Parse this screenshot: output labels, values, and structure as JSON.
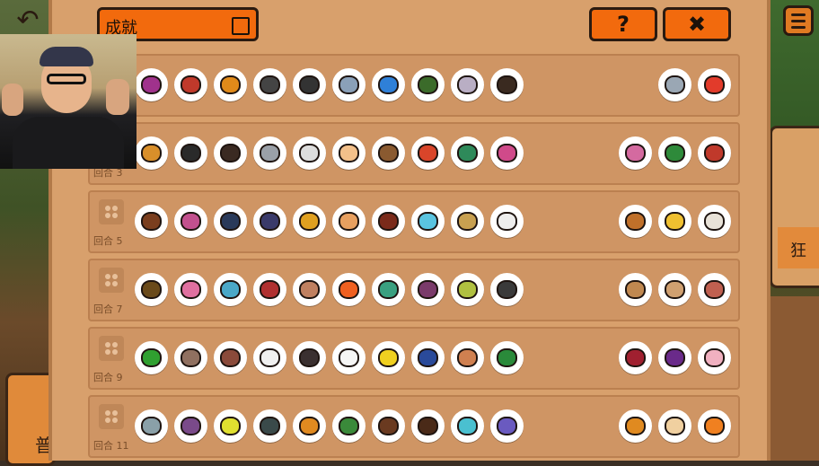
{
  "header": {
    "title": "成就",
    "help_label": "?",
    "close_label": "✖"
  },
  "side": {
    "left_card_text": "普",
    "right_card_text": "狂"
  },
  "rows": [
    {
      "label": "",
      "animals": [
        "#a0328c",
        "#c0392b",
        "#e08a1a",
        "#444",
        "#333",
        "#8aa0b8",
        "#2f80d8",
        "#3b6b2a",
        "#b9aec4",
        "#3a2a20"
      ],
      "foods": [
        "#9aa7b4",
        "#e23b2b"
      ]
    },
    {
      "label": "回合 3",
      "animals": [
        "#d98f2a",
        "#2a2a2a",
        "#3a2a22",
        "#9aa0a8",
        "#ddd",
        "#f3c08a",
        "#8a5a30",
        "#d9452a",
        "#2e8a5a",
        "#d04a8a"
      ],
      "foods": [
        "#d46aa0",
        "#2e8a3a",
        "#c0392b"
      ]
    },
    {
      "label": "回合 5",
      "animals": [
        "#7a3e1e",
        "#c2508e",
        "#2a3a5a",
        "#3a3a6a",
        "#e0a020",
        "#e8a060",
        "#7a2a1a",
        "#5ac4e0",
        "#c8a050",
        "#eeeeee"
      ],
      "foods": [
        "#c0702a",
        "#f0c030",
        "#e8e2d8"
      ]
    },
    {
      "label": "回合 7",
      "animals": [
        "#6a4a1a",
        "#e070a0",
        "#4aa8c8",
        "#b03030",
        "#c08060",
        "#f06020",
        "#3aa080",
        "#7a3a6a",
        "#b0c040",
        "#3a3a3a"
      ],
      "foods": [
        "#c08850",
        "#d0a070",
        "#c06050"
      ]
    },
    {
      "label": "回合 9",
      "animals": [
        "#30a030",
        "#907060",
        "#8a4a3a",
        "#f0f0f0",
        "#3a3030",
        "#f5f5f5",
        "#f0d020",
        "#2a4a9a",
        "#d08050",
        "#2a8a3a"
      ],
      "foods": [
        "#a02030",
        "#6a2a8a",
        "#f0b0c0"
      ]
    },
    {
      "label": "回合 11",
      "animals": [
        "#8aa0a8",
        "#7a4a8a",
        "#e0e030",
        "#3a4a4a",
        "#e08a20",
        "#3a8a3a",
        "#6a3a20",
        "#4a2a18",
        "#4ac0d0",
        "#6a5ac0"
      ],
      "foods": [
        "#e08a20",
        "#f0d0a0",
        "#f08020"
      ]
    }
  ]
}
